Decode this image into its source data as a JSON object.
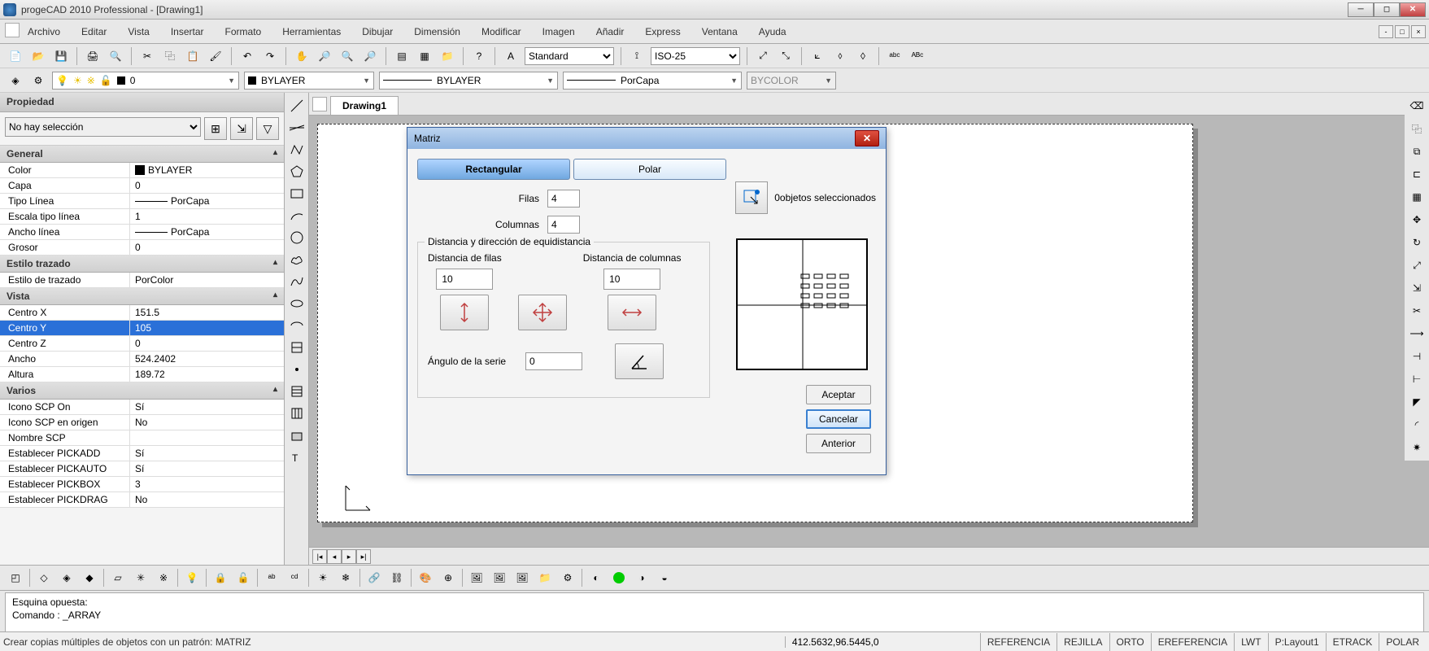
{
  "window": {
    "title": "progeCAD 2010 Professional - [Drawing1]"
  },
  "menu": [
    "Archivo",
    "Editar",
    "Vista",
    "Insertar",
    "Formato",
    "Herramientas",
    "Dibujar",
    "Dimensión",
    "Modificar",
    "Imagen",
    "Añadir",
    "Express",
    "Ventana",
    "Ayuda"
  ],
  "styles": {
    "text": "Standard",
    "dim": "ISO-25"
  },
  "layer_drop": {
    "name": "0",
    "layer": "BYLAYER",
    "ltype": "BYLAYER",
    "lweight": "PorCapa",
    "color": "BYCOLOR"
  },
  "doc_tab": "Drawing1",
  "prop_panel": {
    "title": "Propiedad",
    "selection": "No hay selección",
    "sections": {
      "general": {
        "title": "General",
        "rows": [
          {
            "k": "Color",
            "v": "BYLAYER",
            "swatch": true
          },
          {
            "k": "Capa",
            "v": "0"
          },
          {
            "k": "Tipo Línea",
            "v": "PorCapa",
            "line": true
          },
          {
            "k": "Escala tipo línea",
            "v": "1"
          },
          {
            "k": "Ancho línea",
            "v": "PorCapa",
            "line": true
          },
          {
            "k": "Grosor",
            "v": "0"
          }
        ]
      },
      "estilo": {
        "title": "Estilo trazado",
        "rows": [
          {
            "k": "Estilo de trazado",
            "v": "PorColor"
          }
        ]
      },
      "vista": {
        "title": "Vista",
        "rows": [
          {
            "k": "Centro X",
            "v": "151.5"
          },
          {
            "k": "Centro Y",
            "v": "105",
            "sel": true
          },
          {
            "k": "Centro Z",
            "v": "0"
          },
          {
            "k": "Ancho",
            "v": "524.2402"
          },
          {
            "k": "Altura",
            "v": "189.72"
          }
        ]
      },
      "varios": {
        "title": "Varios",
        "rows": [
          {
            "k": "Icono SCP On",
            "v": "Sí"
          },
          {
            "k": "Icono SCP en origen",
            "v": "No"
          },
          {
            "k": "Nombre SCP",
            "v": ""
          },
          {
            "k": "Establecer PICKADD",
            "v": "Sí"
          },
          {
            "k": "Establecer PICKAUTO",
            "v": "Sí"
          },
          {
            "k": "Establecer PICKBOX",
            "v": "3"
          },
          {
            "k": "Establecer PICKDRAG",
            "v": "No"
          }
        ]
      }
    }
  },
  "dialog": {
    "title": "Matriz",
    "tab_rect": "Rectangular",
    "tab_polar": "Polar",
    "sel_objs_label": "0objetos seleccionados",
    "filas_label": "Filas",
    "filas_val": "4",
    "cols_label": "Columnas",
    "cols_val": "4",
    "group_legend": "Distancia y dirección de equidistancia",
    "dist_filas_label": "Distancia de filas",
    "dist_filas_val": "10",
    "dist_cols_label": "Distancia de columnas",
    "dist_cols_val": "10",
    "angle_label": "Ángulo de la serie",
    "angle_val": "0",
    "btn_accept": "Aceptar",
    "btn_cancel": "Cancelar",
    "btn_prev": "Anterior"
  },
  "cmdline": {
    "line1": "Esquina opuesta:",
    "line2": "Comando : _ARRAY"
  },
  "status": {
    "hint": "Crear copias múltiples de objetos con un patrón:  MATRIZ",
    "coords": "412.5632,96.5445,0",
    "toggles": [
      "REFERENCIA",
      "REJILLA",
      "ORTO",
      "EREFERENCIA",
      "LWT",
      "P:Layout1",
      "ETRACK",
      "POLAR"
    ]
  }
}
